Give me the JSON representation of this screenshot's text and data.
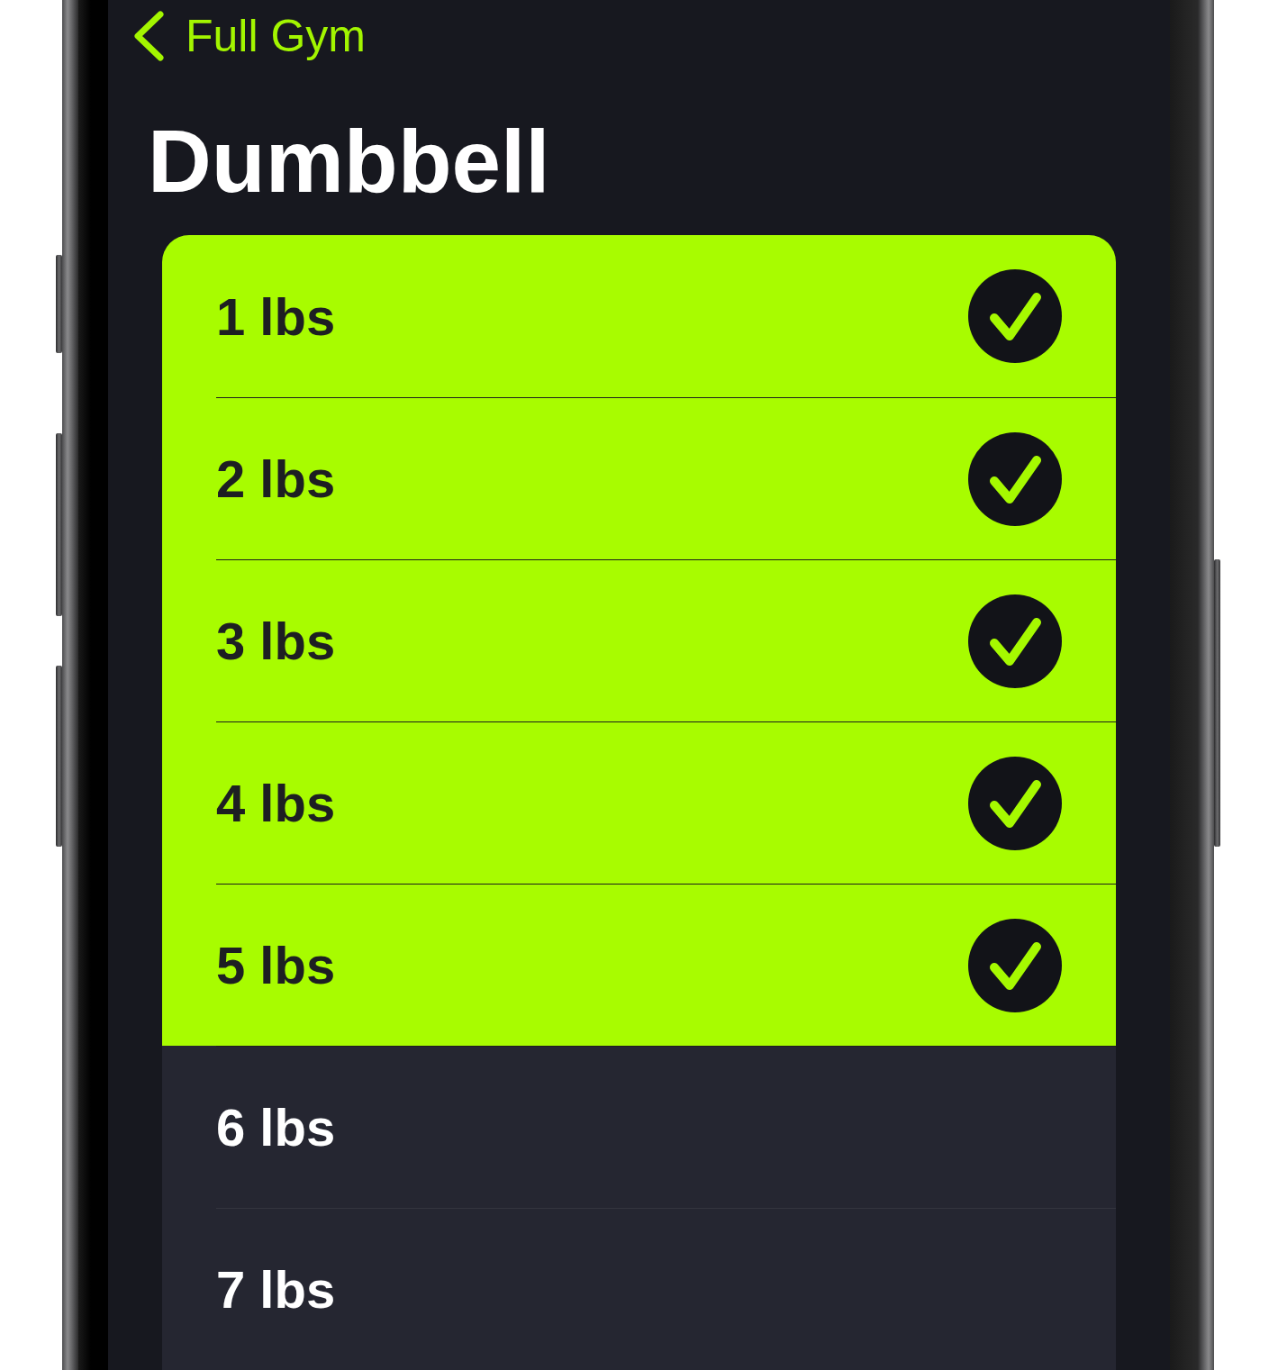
{
  "nav": {
    "back_label": "Full Gym"
  },
  "title": "Dumbbell",
  "rows": [
    {
      "label": "1 lbs",
      "selected": true
    },
    {
      "label": "2 lbs",
      "selected": true
    },
    {
      "label": "3 lbs",
      "selected": true
    },
    {
      "label": "4 lbs",
      "selected": true
    },
    {
      "label": "5 lbs",
      "selected": true
    },
    {
      "label": "6 lbs",
      "selected": false
    },
    {
      "label": "7 lbs",
      "selected": false
    }
  ]
}
